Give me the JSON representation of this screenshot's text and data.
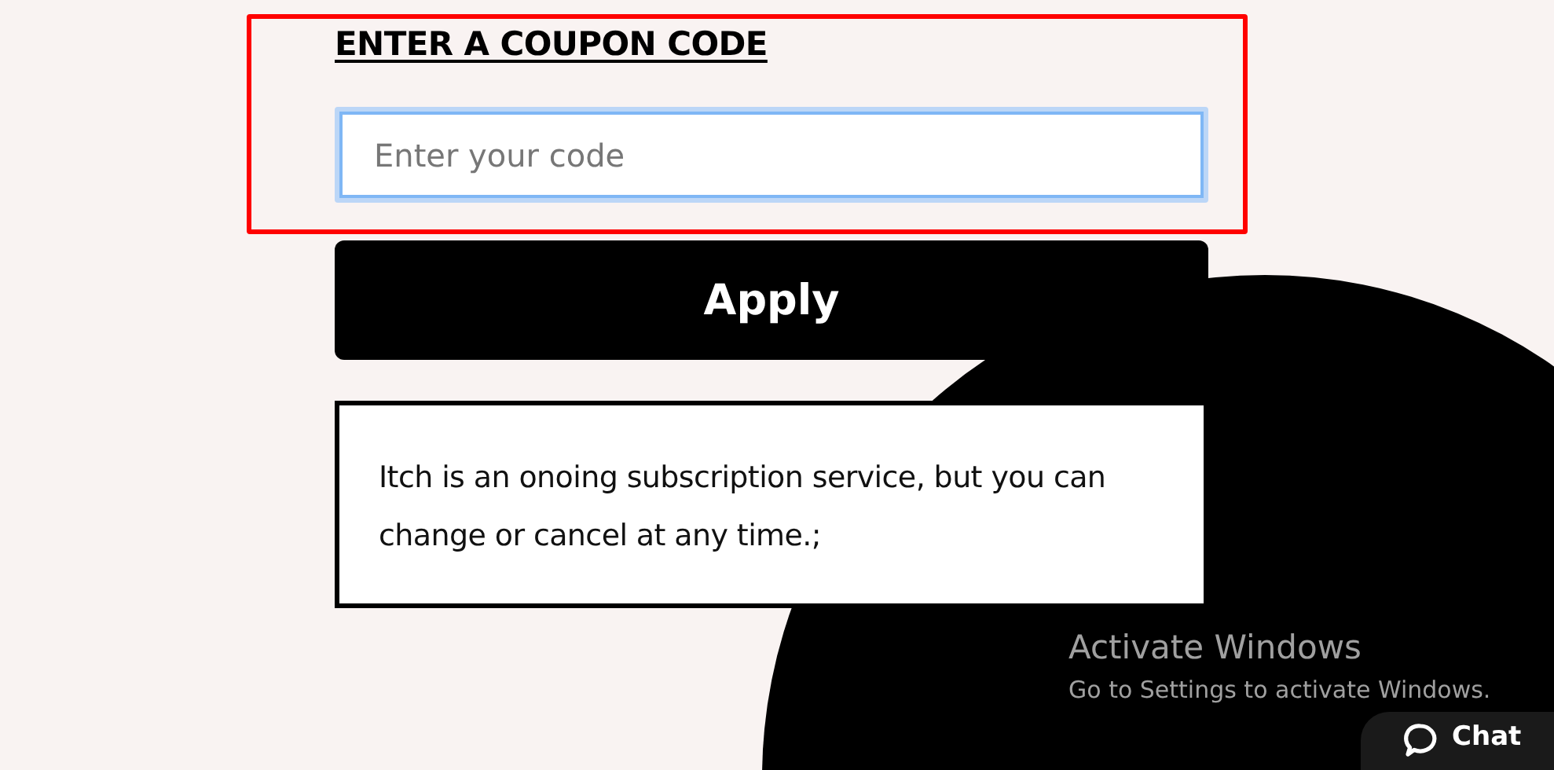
{
  "coupon": {
    "heading": "ENTER A COUPON CODE",
    "input": {
      "placeholder": "Enter your code",
      "focused": true
    },
    "apply_button": "Apply",
    "note": "Itch is an onoing subscription service, but you can change or cancel at any time.;"
  },
  "activation_notice": {
    "title": "Activate Windows",
    "subtitle": "Go to Settings to activate Windows."
  },
  "chat_button": {
    "label": "Chat"
  }
}
